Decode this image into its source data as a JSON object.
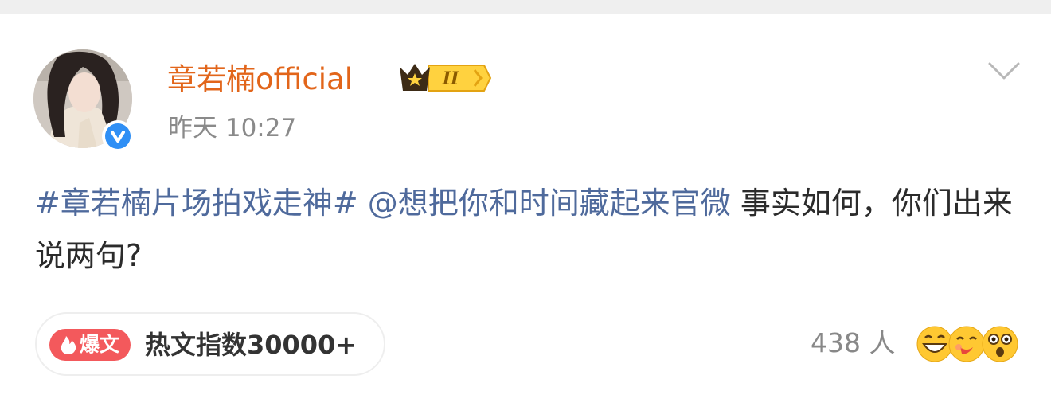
{
  "post": {
    "username": "章若楠official",
    "vip_level": "II",
    "timestamp": "昨天 10:27",
    "content": {
      "hashtag": "#章若楠片场拍戏走神#",
      "mention": "@想把你和时间藏起来官微",
      "text": "事实如何，你们出来说两句?"
    }
  },
  "footer": {
    "hot_tag_label": "爆文",
    "hot_index": "热文指数30000+",
    "reaction_count": "438 人"
  },
  "icons": {
    "verified": "verified-badge-icon",
    "menu": "chevron-down-icon",
    "hot": "fire-icon",
    "vip": "crown-icon",
    "reactions": [
      "laughing-emoji-icon",
      "kiss-emoji-icon",
      "surprised-emoji-icon"
    ]
  },
  "colors": {
    "username": "#e2651a",
    "link": "#4f6a9c",
    "hot_tag": "#f3595c",
    "verified": "#2f8ff5"
  }
}
